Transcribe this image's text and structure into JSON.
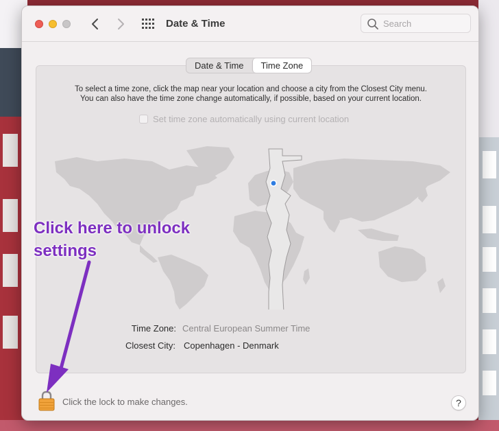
{
  "window": {
    "title": "Date & Time"
  },
  "search": {
    "placeholder": "Search"
  },
  "tabs": [
    {
      "label": "Date & Time",
      "selected": false
    },
    {
      "label": "Time Zone",
      "selected": true
    }
  ],
  "instructions": {
    "line1": "To select a time zone, click the map near your location and choose a city from the Closest City menu.",
    "line2": "You can also have the time zone change automatically, if possible, based on your current location."
  },
  "auto_time_zone": {
    "label": "Set time zone automatically using current location",
    "checked": false,
    "enabled": false
  },
  "time_zone": {
    "label": "Time Zone:",
    "value": "Central European Summer Time"
  },
  "closest_city": {
    "label": "Closest City:",
    "value": "Copenhagen - Denmark"
  },
  "lock": {
    "text": "Click the lock to make changes."
  },
  "help": {
    "label": "?"
  },
  "annotation": {
    "text": "Click here to unlock settings",
    "color": "#7d2fc0"
  },
  "icons": [
    "back-chevron-icon",
    "forward-chevron-icon",
    "grid-icon",
    "search-icon",
    "lock-icon",
    "help-icon",
    "location-dot-icon"
  ],
  "colors": {
    "close": "#ee5e56",
    "minimize": "#f6be2f",
    "zoom_disabled": "#c8c6c7",
    "lock": "#f0a23a",
    "location_dot": "#2f7de1"
  }
}
